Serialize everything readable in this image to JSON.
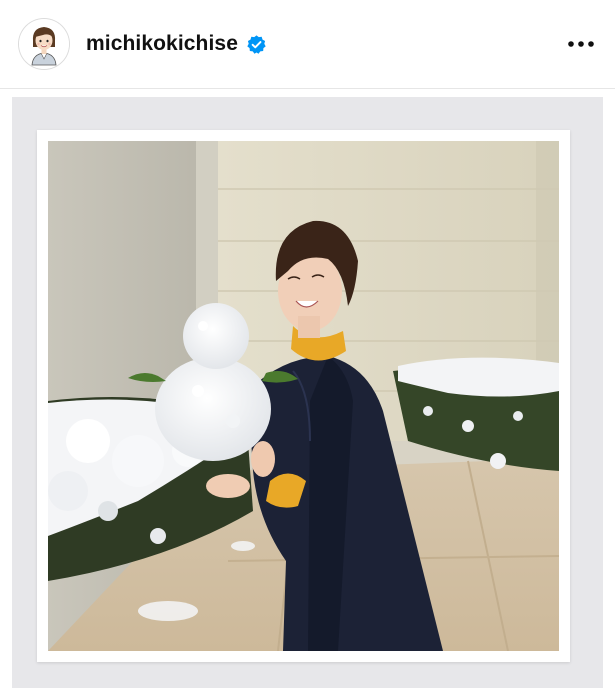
{
  "post": {
    "username": "michikokichise",
    "verified": true
  },
  "icons": {
    "avatar": "avatar-cartoon-icon",
    "verified": "verified-badge-icon",
    "more": "more-options-icon"
  },
  "colors": {
    "accent_verified": "#0095f6",
    "text_primary": "#111111",
    "media_background": "#e7e7ea"
  }
}
